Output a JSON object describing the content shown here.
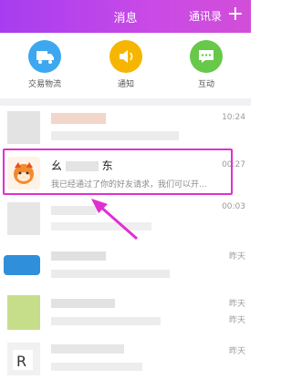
{
  "header": {
    "title": "消息",
    "contacts": "通讯录",
    "plus": "+"
  },
  "quick": [
    {
      "label": "交易物流",
      "icon": "truck-icon",
      "color": "#3da8ef"
    },
    {
      "label": "通知",
      "icon": "speaker-icon",
      "color": "#f6b500"
    },
    {
      "label": "互动",
      "icon": "chat-bubble-icon",
      "color": "#67c84a"
    }
  ],
  "rows": [
    {
      "time": "10:24"
    },
    {
      "name": "幺",
      "name_tail": "东",
      "preview": "我已经通过了你的好友请求，我们可以开...",
      "time": "00:27"
    },
    {
      "time": "00:03"
    },
    {
      "time": "昨天"
    },
    {
      "time": "昨天"
    },
    {
      "time": "昨天"
    },
    {
      "time": "昨天"
    }
  ],
  "colors": {
    "header": "#b447ea",
    "highlight": "#e12fd0"
  }
}
